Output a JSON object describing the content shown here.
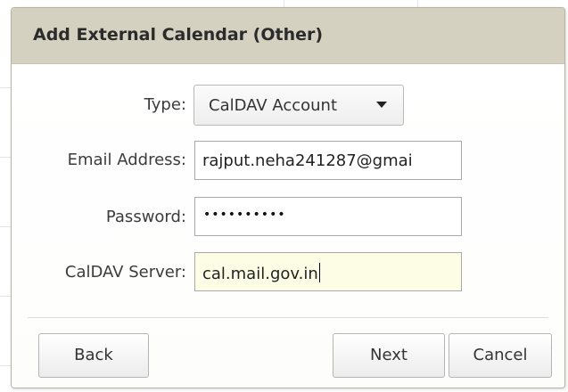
{
  "dialog": {
    "title": "Add External Calendar (Other)"
  },
  "form": {
    "type_label": "Type:",
    "type_value": "CalDAV Account",
    "email_label": "Email Address:",
    "email_value": "rajput.neha241287@gmai",
    "password_label": "Password:",
    "password_value": "••••••••••",
    "server_label": "CalDAV Server:",
    "server_value": "cal.mail.gov.in"
  },
  "buttons": {
    "back": "Back",
    "next": "Next",
    "cancel": "Cancel"
  },
  "icons": {
    "dropdown": "chevron-down-icon"
  },
  "colors": {
    "titlebar": "#d5d1c1",
    "focused_input": "#fdfde6"
  }
}
